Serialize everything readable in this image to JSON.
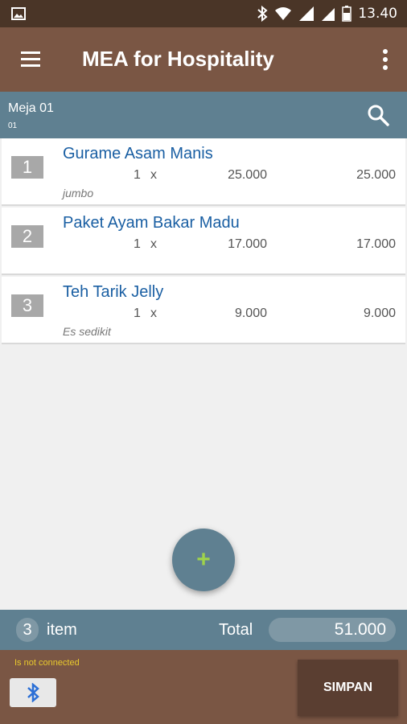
{
  "status_bar": {
    "time": "13.40"
  },
  "app_bar": {
    "title": "MEA for Hospitality"
  },
  "table": {
    "name": "Meja 01",
    "code": "01"
  },
  "orders": [
    {
      "no": "1",
      "name": "Gurame Asam Manis",
      "qty": "1",
      "x": "x",
      "price": "25.000",
      "subtotal": "25.000",
      "note": "jumbo"
    },
    {
      "no": "2",
      "name": "Paket Ayam Bakar Madu",
      "qty": "1",
      "x": "x",
      "price": "17.000",
      "subtotal": "17.000",
      "note": ""
    },
    {
      "no": "3",
      "name": "Teh Tarik Jelly",
      "qty": "1",
      "x": "x",
      "price": "9.000",
      "subtotal": "9.000",
      "note": "Es sedikit"
    }
  ],
  "fab": {
    "label": "+"
  },
  "summary": {
    "count": "3",
    "item_label": "item",
    "total_label": "Total",
    "total_value": "51.000"
  },
  "footer": {
    "connection_status": "Is not connected",
    "save_label": "SIMPAN"
  },
  "colors": {
    "brown_dark": "#4a3527",
    "brown": "#7a5644",
    "slate": "#5f8091",
    "accent_green": "#9fd34b",
    "link_blue": "#1a5fa3",
    "warning_yellow": "#e9c92d"
  },
  "icons": [
    "image-icon",
    "bluetooth-icon",
    "wifi-icon",
    "signal-icon",
    "battery-icon",
    "menu-icon",
    "more-vert-icon",
    "search-icon",
    "add-icon"
  ]
}
